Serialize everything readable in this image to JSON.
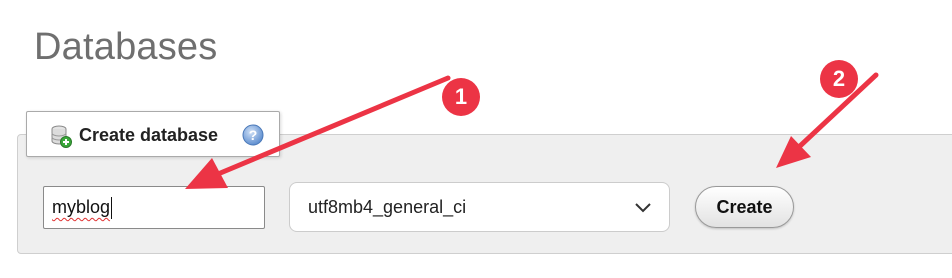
{
  "page": {
    "title": "Databases"
  },
  "create_database": {
    "legend": "Create database",
    "icons": {
      "database": "database-add-icon",
      "help": "help-icon"
    },
    "name_input": {
      "value": "myblog"
    },
    "collation_select": {
      "selected": "utf8mb4_general_ci"
    },
    "create_button": {
      "label": "Create"
    }
  },
  "annotations": {
    "color": "#ec3445",
    "steps": [
      {
        "number": "1"
      },
      {
        "number": "2"
      }
    ]
  }
}
